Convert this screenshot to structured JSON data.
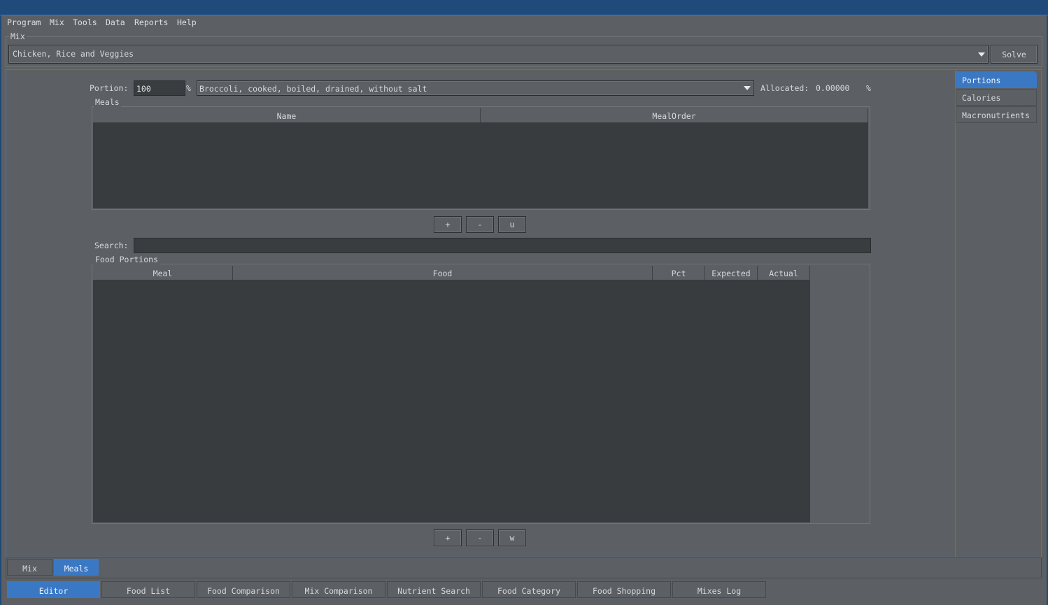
{
  "menu": [
    "Program",
    "Mix",
    "Tools",
    "Data",
    "Reports",
    "Help"
  ],
  "mix_group": {
    "title": "Mix",
    "selected_mix": "Chicken, Rice and Veggies",
    "solve_label": "Solve"
  },
  "portion": {
    "label": "Portion:",
    "value": "100",
    "percent": "%",
    "food": "Broccoli, cooked, boiled, drained, without salt",
    "allocated_label": "Allocated:",
    "allocated_value": "0.00000",
    "allocated_percent": "%"
  },
  "meals": {
    "title": "Meals",
    "columns": [
      "Name",
      "MealOrder"
    ],
    "buttons": [
      "+",
      "-",
      "u"
    ]
  },
  "search": {
    "label": "Search:",
    "value": ""
  },
  "food_portions": {
    "title": "Food Portions",
    "columns": [
      "Meal",
      "Food",
      "Pct",
      "Expected",
      "Actual"
    ],
    "buttons": [
      "+",
      "-",
      "w"
    ]
  },
  "side_tabs": [
    "Portions",
    "Calories",
    "Macronutrients"
  ],
  "inner_tabs": [
    "Mix",
    "Meals"
  ],
  "bottom_tabs": [
    "Editor",
    "Food List",
    "Food Comparison",
    "Mix Comparison",
    "Nutrient Search",
    "Food Category",
    "Food Shopping",
    "Mixes Log"
  ],
  "colors": {
    "accent": "#3b78c4",
    "background": "#5c6064",
    "table": "#393c3f"
  }
}
